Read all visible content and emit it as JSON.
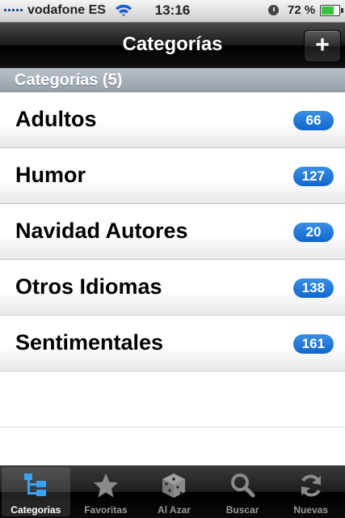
{
  "status_bar": {
    "carrier": "vodafone ES",
    "time": "13:16",
    "battery_percent_text": "72 %",
    "battery_level": 0.72
  },
  "nav": {
    "title": "Categorías",
    "add_label": "+"
  },
  "section": {
    "title": "Categorías (5)"
  },
  "categories": [
    {
      "label": "Adultos",
      "count": "66"
    },
    {
      "label": "Humor",
      "count": "127"
    },
    {
      "label": "Navidad Autores",
      "count": "20"
    },
    {
      "label": "Otros Idiomas",
      "count": "138"
    },
    {
      "label": "Sentimentales",
      "count": "161"
    }
  ],
  "tabs": [
    {
      "label": "Categorias",
      "icon": "hierarchy-icon",
      "active": true
    },
    {
      "label": "Favoritas",
      "icon": "star-icon",
      "active": false
    },
    {
      "label": "Al Azar",
      "icon": "dice-icon",
      "active": false
    },
    {
      "label": "Buscar",
      "icon": "magnifier-icon",
      "active": false
    },
    {
      "label": "Nuevas",
      "icon": "refresh-icon",
      "active": false
    }
  ],
  "colors": {
    "badge": "#1a73d6",
    "tab_active_text": "#ffffff",
    "tab_inactive_text": "#9a9a9a",
    "tab_active_icon": "#3aa0f0"
  }
}
